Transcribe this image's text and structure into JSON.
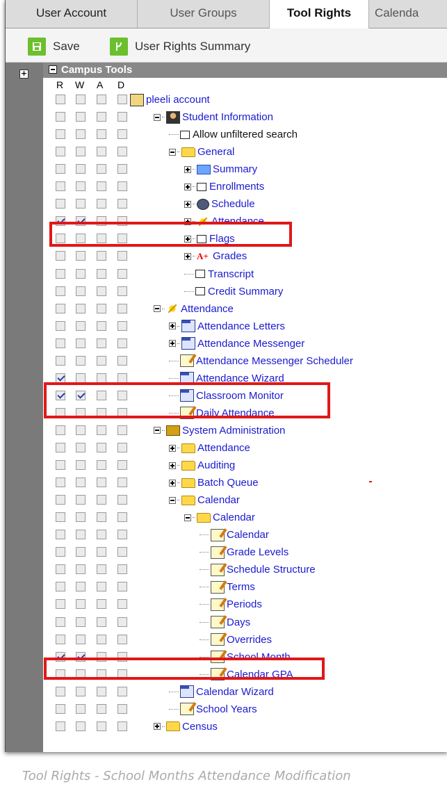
{
  "tabs": [
    {
      "label": "User Account"
    },
    {
      "label": "User Groups"
    },
    {
      "label": "Tool Rights"
    },
    {
      "label": "Calenda"
    }
  ],
  "toolbar": {
    "save_label": "Save",
    "summary_label": "User Rights Summary"
  },
  "tree": {
    "root_label": "Campus Tools",
    "columns": [
      "R",
      "W",
      "A",
      "D"
    ],
    "rows": [
      {
        "label": "pleeli account",
        "depth": 0,
        "expander": "none",
        "icon": "account-icon",
        "black": false,
        "checks": [
          0,
          0,
          0,
          0
        ]
      },
      {
        "label": "Student Information",
        "depth": 1,
        "expander": "minus",
        "icon": "person-icon",
        "black": false,
        "checks": [
          0,
          0,
          0,
          0
        ]
      },
      {
        "label": "Allow unfiltered search",
        "depth": 2,
        "expander": "dots",
        "icon": "page-icon",
        "black": true,
        "checks": [
          0,
          0,
          0,
          0
        ]
      },
      {
        "label": "General",
        "depth": 2,
        "expander": "minus",
        "icon": "folder-icon",
        "black": false,
        "checks": [
          0,
          0,
          0,
          0
        ]
      },
      {
        "label": "Summary",
        "depth": 3,
        "expander": "plus",
        "icon": "summary-icon",
        "black": false,
        "checks": [
          0,
          0,
          0,
          0
        ]
      },
      {
        "label": "Enrollments",
        "depth": 3,
        "expander": "plus",
        "icon": "page-icon",
        "black": false,
        "checks": [
          0,
          0,
          0,
          0
        ]
      },
      {
        "label": "Schedule",
        "depth": 3,
        "expander": "plus",
        "icon": "schedule-icon",
        "black": false,
        "checks": [
          0,
          0,
          0,
          0
        ]
      },
      {
        "label": "Attendance",
        "depth": 3,
        "expander": "plus",
        "icon": "sun-icon",
        "black": false,
        "checks": [
          1,
          1,
          0,
          0
        ]
      },
      {
        "label": "Flags",
        "depth": 3,
        "expander": "plus",
        "icon": "page-icon",
        "black": false,
        "checks": [
          0,
          0,
          0,
          0
        ]
      },
      {
        "label": "Grades",
        "depth": 3,
        "expander": "plus",
        "icon": "grades-icon",
        "black": false,
        "checks": [
          0,
          0,
          0,
          0
        ]
      },
      {
        "label": "Transcript",
        "depth": 3,
        "expander": "dots",
        "icon": "page-icon",
        "black": false,
        "checks": [
          0,
          0,
          0,
          0
        ]
      },
      {
        "label": "Credit Summary",
        "depth": 3,
        "expander": "dots",
        "icon": "page-icon",
        "black": false,
        "checks": [
          0,
          0,
          0,
          0
        ]
      },
      {
        "label": "Attendance",
        "depth": 1,
        "expander": "minus",
        "icon": "sun-icon",
        "black": false,
        "checks": [
          0,
          0,
          0,
          0
        ]
      },
      {
        "label": "Attendance Letters",
        "depth": 2,
        "expander": "plus",
        "icon": "multi-icon",
        "black": false,
        "checks": [
          0,
          0,
          0,
          0
        ]
      },
      {
        "label": "Attendance Messenger",
        "depth": 2,
        "expander": "plus",
        "icon": "multi-icon",
        "black": false,
        "checks": [
          0,
          0,
          0,
          0
        ]
      },
      {
        "label": "Attendance Messenger Scheduler",
        "depth": 2,
        "expander": "dots",
        "icon": "pen-icon",
        "black": false,
        "checks": [
          0,
          0,
          0,
          0
        ]
      },
      {
        "label": "Attendance Wizard",
        "depth": 2,
        "expander": "dots",
        "icon": "multi-icon",
        "black": false,
        "checks": [
          1,
          0,
          0,
          0
        ]
      },
      {
        "label": "Classroom Monitor",
        "depth": 2,
        "expander": "dots",
        "icon": "multi-icon",
        "black": false,
        "checks": [
          1,
          1,
          0,
          0
        ]
      },
      {
        "label": "Daily Attendance",
        "depth": 2,
        "expander": "dots",
        "icon": "pen-icon",
        "black": false,
        "checks": [
          0,
          0,
          0,
          0
        ]
      },
      {
        "label": "System Administration",
        "depth": 1,
        "expander": "minus",
        "icon": "admin-icon",
        "black": false,
        "checks": [
          0,
          0,
          0,
          0
        ]
      },
      {
        "label": "Attendance",
        "depth": 2,
        "expander": "plus",
        "icon": "folder-icon",
        "black": false,
        "checks": [
          0,
          0,
          0,
          0
        ]
      },
      {
        "label": "Auditing",
        "depth": 2,
        "expander": "plus",
        "icon": "folder-icon",
        "black": false,
        "checks": [
          0,
          0,
          0,
          0
        ]
      },
      {
        "label": "Batch Queue",
        "depth": 2,
        "expander": "plus",
        "icon": "folder-icon",
        "black": false,
        "checks": [
          0,
          0,
          0,
          0
        ]
      },
      {
        "label": "Calendar",
        "depth": 2,
        "expander": "minus",
        "icon": "folder-icon",
        "black": false,
        "checks": [
          0,
          0,
          0,
          0
        ]
      },
      {
        "label": "Calendar",
        "depth": 3,
        "expander": "minus",
        "icon": "folder-icon",
        "black": false,
        "checks": [
          0,
          0,
          0,
          0
        ]
      },
      {
        "label": "Calendar",
        "depth": 4,
        "expander": "dots",
        "icon": "pen-icon",
        "black": false,
        "checks": [
          0,
          0,
          0,
          0
        ]
      },
      {
        "label": "Grade Levels",
        "depth": 4,
        "expander": "dots",
        "icon": "pen-icon",
        "black": false,
        "checks": [
          0,
          0,
          0,
          0
        ]
      },
      {
        "label": "Schedule Structure",
        "depth": 4,
        "expander": "dots",
        "icon": "pen-icon",
        "black": false,
        "checks": [
          0,
          0,
          0,
          0
        ]
      },
      {
        "label": "Terms",
        "depth": 4,
        "expander": "dots",
        "icon": "pen-icon",
        "black": false,
        "checks": [
          0,
          0,
          0,
          0
        ]
      },
      {
        "label": "Periods",
        "depth": 4,
        "expander": "dots",
        "icon": "pen-icon",
        "black": false,
        "checks": [
          0,
          0,
          0,
          0
        ]
      },
      {
        "label": "Days",
        "depth": 4,
        "expander": "dots",
        "icon": "pen-icon",
        "black": false,
        "checks": [
          0,
          0,
          0,
          0
        ]
      },
      {
        "label": "Overrides",
        "depth": 4,
        "expander": "dots",
        "icon": "pen-icon",
        "black": false,
        "checks": [
          0,
          0,
          0,
          0
        ]
      },
      {
        "label": "School Month",
        "depth": 4,
        "expander": "dots",
        "icon": "pen-icon",
        "black": false,
        "checks": [
          1,
          1,
          0,
          0
        ]
      },
      {
        "label": "Calendar GPA",
        "depth": 4,
        "expander": "dots",
        "icon": "pen-icon",
        "black": false,
        "checks": [
          0,
          0,
          0,
          0
        ]
      },
      {
        "label": "Calendar Wizard",
        "depth": 2,
        "expander": "dots",
        "icon": "multi-icon",
        "black": false,
        "checks": [
          0,
          0,
          0,
          0
        ]
      },
      {
        "label": "School Years",
        "depth": 2,
        "expander": "dots",
        "icon": "pen-icon",
        "black": false,
        "checks": [
          0,
          0,
          0,
          0
        ]
      },
      {
        "label": "Census",
        "depth": 1,
        "expander": "plus",
        "icon": "folder-icon",
        "black": false,
        "checks": [
          0,
          0,
          0,
          0
        ]
      }
    ]
  },
  "caption": "Tool Rights - School Months Attendance Modification",
  "colors": {
    "highlight": "#e01818",
    "link": "#1a1ad0",
    "toolbar_icon": "#6cbf2d",
    "gutter": "#7a7a7a"
  }
}
